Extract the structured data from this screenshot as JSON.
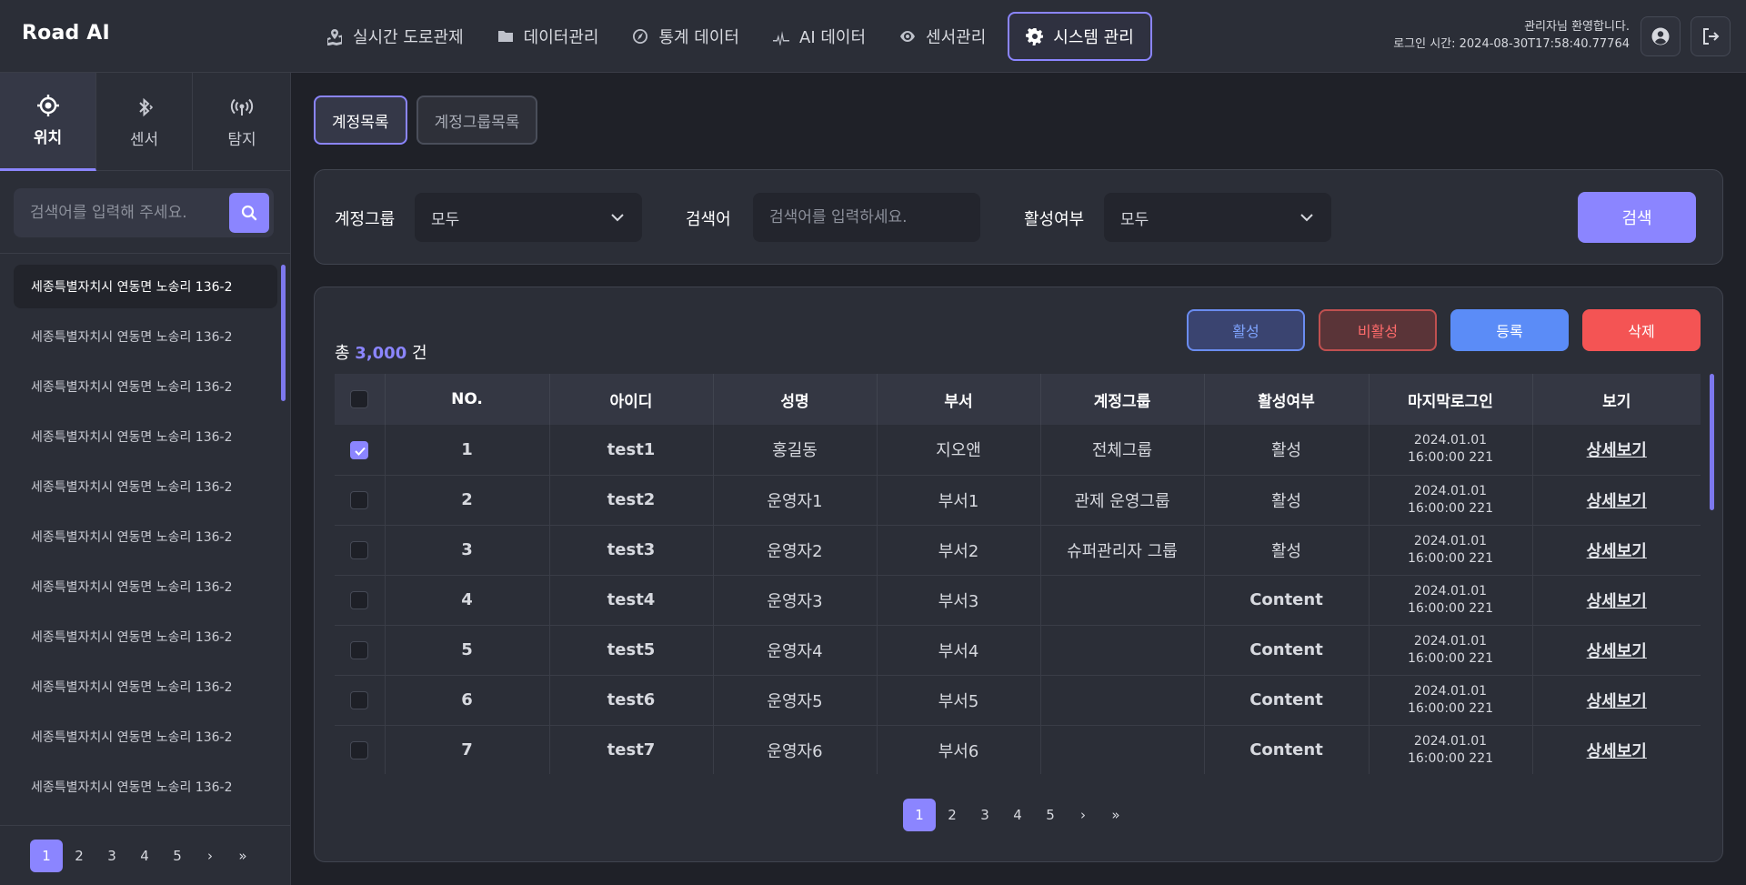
{
  "app": {
    "title": "Road AI"
  },
  "nav": [
    {
      "label": "실시간 도로관제",
      "icon": "map-icon"
    },
    {
      "label": "데이터관리",
      "icon": "folder-icon"
    },
    {
      "label": "통계 데이터",
      "icon": "compass-icon"
    },
    {
      "label": "AI 데이터",
      "icon": "ai-icon"
    },
    {
      "label": "센서관리",
      "icon": "eye-icon"
    },
    {
      "label": "시스템 관리",
      "icon": "gear-icon",
      "active": true
    }
  ],
  "user": {
    "welcome": "관리자님 환영합니다.",
    "login_time": "로그인 시간: 2024-08-30T17:58:40.77764"
  },
  "sidebar": {
    "tabs": [
      {
        "label": "위치",
        "icon": "location-icon",
        "active": true
      },
      {
        "label": "센서",
        "icon": "bluetooth-icon"
      },
      {
        "label": "탐지",
        "icon": "broadcast-icon"
      }
    ],
    "search_placeholder": "검색어를 입력해 주세요.",
    "items": [
      "세종특별자치시 연동면 노송리 136-2",
      "세종특별자치시 연동면 노송리 136-2",
      "세종특별자치시 연동면 노송리 136-2",
      "세종특별자치시 연동면 노송리 136-2",
      "세종특별자치시 연동면 노송리 136-2",
      "세종특별자치시 연동면 노송리 136-2",
      "세종특별자치시 연동면 노송리 136-2",
      "세종특별자치시 연동면 노송리 136-2",
      "세종특별자치시 연동면 노송리 136-2",
      "세종특별자치시 연동면 노송리 136-2",
      "세종특별자치시 연동면 노송리 136-2"
    ],
    "pager": [
      "1",
      "2",
      "3",
      "4",
      "5",
      "›",
      "»"
    ]
  },
  "sub_tabs": [
    {
      "label": "계정목록",
      "active": true
    },
    {
      "label": "계정그룹목록"
    }
  ],
  "filter": {
    "group_label": "계정그룹",
    "group_value": "모두",
    "keyword_label": "검색어",
    "keyword_placeholder": "검색어를 입력하세요.",
    "status_label": "활성여부",
    "status_value": "모두",
    "search_button": "검색"
  },
  "table": {
    "total_prefix": "총",
    "total_count": "3,000",
    "total_suffix": "건",
    "buttons": {
      "activate": "활성",
      "deactivate": "비활성",
      "register": "등록",
      "delete": "삭제"
    },
    "columns": [
      "NO.",
      "아이디",
      "성명",
      "부서",
      "계정그룹",
      "활성여부",
      "마지막로그인",
      "보기"
    ],
    "rows": [
      {
        "checked": true,
        "no": "1",
        "id": "test1",
        "name": "홍길동",
        "dept": "지오앤",
        "group": "전체그룹",
        "status": "활성",
        "date1": "2024.01.01",
        "date2": "16:00:00 221",
        "view": "상세보기"
      },
      {
        "checked": false,
        "no": "2",
        "id": "test2",
        "name": "운영자1",
        "dept": "부서1",
        "group": "관제 운영그룹",
        "status": "활성",
        "date1": "2024.01.01",
        "date2": "16:00:00 221",
        "view": "상세보기"
      },
      {
        "checked": false,
        "no": "3",
        "id": "test3",
        "name": "운영자2",
        "dept": "부서2",
        "group": "슈퍼관리자 그룹",
        "status": "활성",
        "date1": "2024.01.01",
        "date2": "16:00:00 221",
        "view": "상세보기"
      },
      {
        "checked": false,
        "no": "4",
        "id": "test4",
        "name": "운영자3",
        "dept": "부서3",
        "group": "",
        "status": "Content",
        "date1": "2024.01.01",
        "date2": "16:00:00 221",
        "view": "상세보기"
      },
      {
        "checked": false,
        "no": "5",
        "id": "test5",
        "name": "운영자4",
        "dept": "부서4",
        "group": "",
        "status": "Content",
        "date1": "2024.01.01",
        "date2": "16:00:00 221",
        "view": "상세보기"
      },
      {
        "checked": false,
        "no": "6",
        "id": "test6",
        "name": "운영자5",
        "dept": "부서5",
        "group": "",
        "status": "Content",
        "date1": "2024.01.01",
        "date2": "16:00:00 221",
        "view": "상세보기"
      },
      {
        "checked": false,
        "no": "7",
        "id": "test7",
        "name": "운영자6",
        "dept": "부서6",
        "group": "",
        "status": "Content",
        "date1": "2024.01.01",
        "date2": "16:00:00 221",
        "view": "상세보기"
      }
    ],
    "pager": [
      "1",
      "2",
      "3",
      "4",
      "5",
      "›",
      "»"
    ]
  },
  "colors": {
    "accent": "#8b85ff",
    "register": "#5b8cf7",
    "delete": "#f45454"
  }
}
